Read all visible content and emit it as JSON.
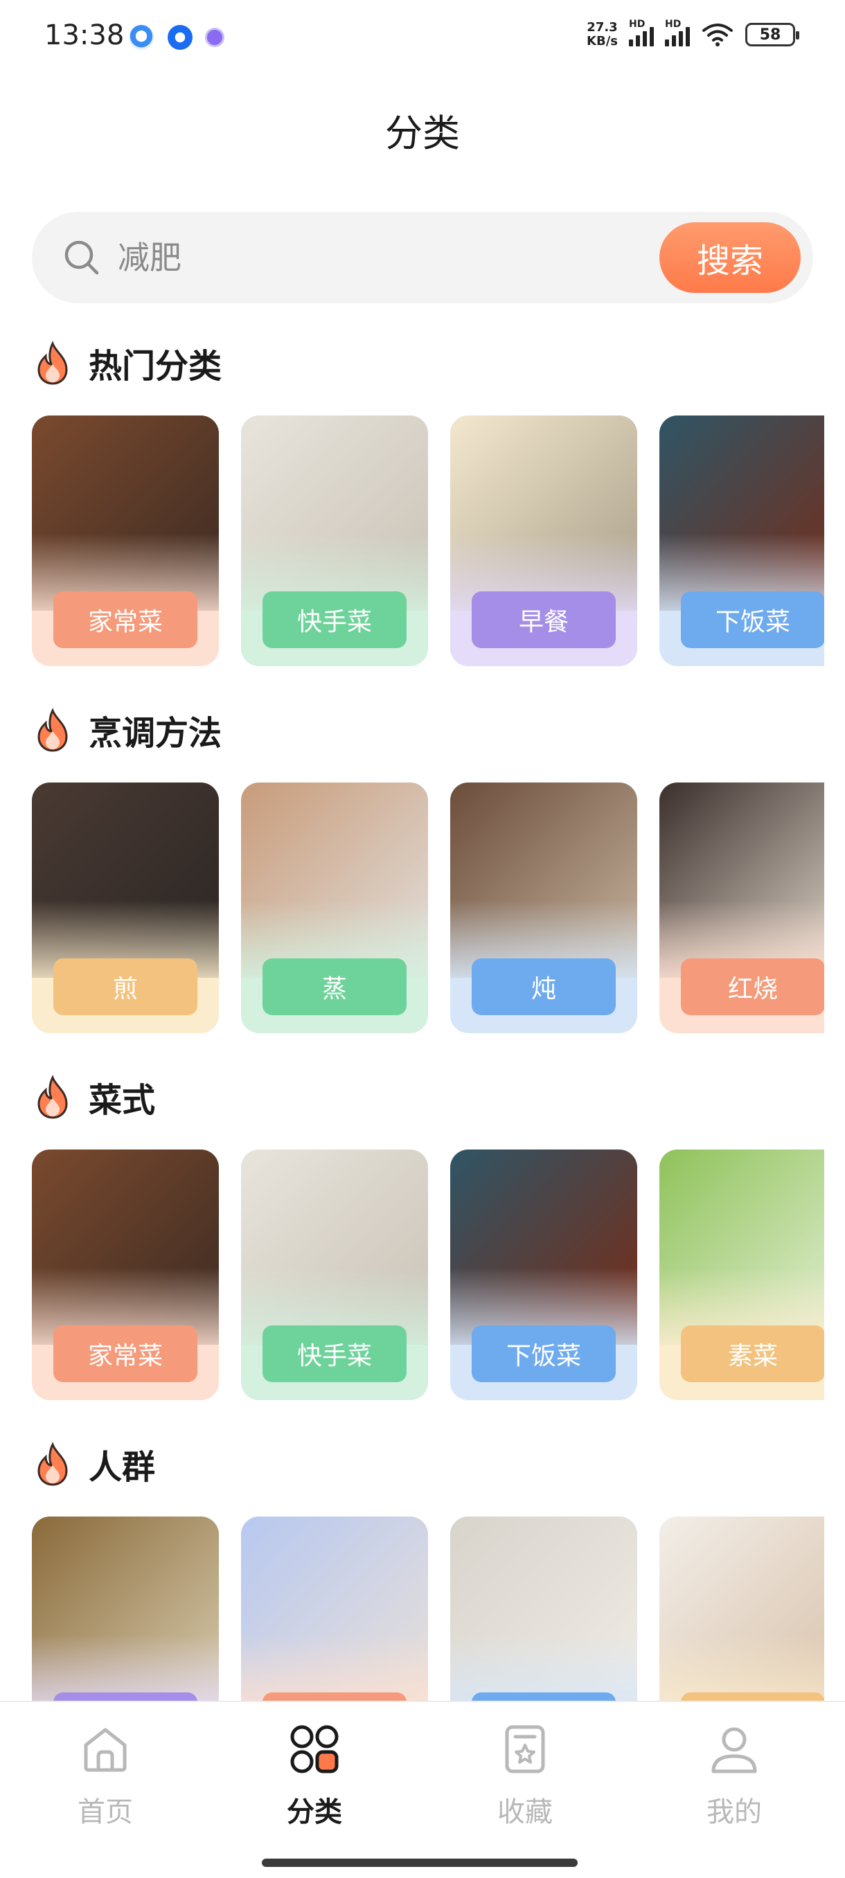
{
  "status_bar": {
    "time": "13:38",
    "net_speed_value": "27.3",
    "net_speed_unit": "KB/s",
    "hd_label": "HD",
    "battery": "58"
  },
  "page": {
    "title": "分类"
  },
  "search": {
    "placeholder": "减肥",
    "button_label": "搜索"
  },
  "sections": [
    {
      "title": "热门分类",
      "cards": [
        {
          "label": "家常菜",
          "label_color": "#f59a7a",
          "bg_color": "#fde0d2"
        },
        {
          "label": "快手菜",
          "label_color": "#6ed39a",
          "bg_color": "#d4f0de"
        },
        {
          "label": "早餐",
          "label_color": "#a58ee8",
          "bg_color": "#e4dcf8"
        },
        {
          "label": "下饭菜",
          "label_color": "#6eaaee",
          "bg_color": "#d6e6f8"
        }
      ]
    },
    {
      "title": "烹调方法",
      "cards": [
        {
          "label": "煎",
          "label_color": "#f2c27e",
          "bg_color": "#fbeccd"
        },
        {
          "label": "蒸",
          "label_color": "#6ed39a",
          "bg_color": "#d4f0de"
        },
        {
          "label": "炖",
          "label_color": "#6eaaee",
          "bg_color": "#d6e6f8"
        },
        {
          "label": "红烧",
          "label_color": "#f59a7a",
          "bg_color": "#fde0d2"
        }
      ]
    },
    {
      "title": "菜式",
      "cards": [
        {
          "label": "家常菜",
          "label_color": "#f59a7a",
          "bg_color": "#fde0d2"
        },
        {
          "label": "快手菜",
          "label_color": "#6ed39a",
          "bg_color": "#d4f0de"
        },
        {
          "label": "下饭菜",
          "label_color": "#6eaaee",
          "bg_color": "#d6e6f8"
        },
        {
          "label": "素菜",
          "label_color": "#f2c27e",
          "bg_color": "#fbeccd"
        }
      ]
    },
    {
      "title": "人群",
      "cards": [
        {
          "label": "",
          "label_color": "#a58ee8",
          "bg_color": "#e4dcf8"
        },
        {
          "label": "",
          "label_color": "#f59a7a",
          "bg_color": "#fde0d2"
        },
        {
          "label": "",
          "label_color": "#6eaaee",
          "bg_color": "#d6e6f8"
        },
        {
          "label": "",
          "label_color": "#f2c27e",
          "bg_color": "#fbeccd"
        }
      ]
    }
  ],
  "bottom_nav": [
    {
      "label": "首页",
      "icon": "home-icon",
      "active": false
    },
    {
      "label": "分类",
      "icon": "category-icon",
      "active": true
    },
    {
      "label": "收藏",
      "icon": "favorites-icon",
      "active": false
    },
    {
      "label": "我的",
      "icon": "profile-icon",
      "active": false
    }
  ],
  "colors": {
    "accent": "#ff7a4a",
    "search_bg": "#f2f3f2",
    "inactive_nav": "#b8b8b8"
  }
}
